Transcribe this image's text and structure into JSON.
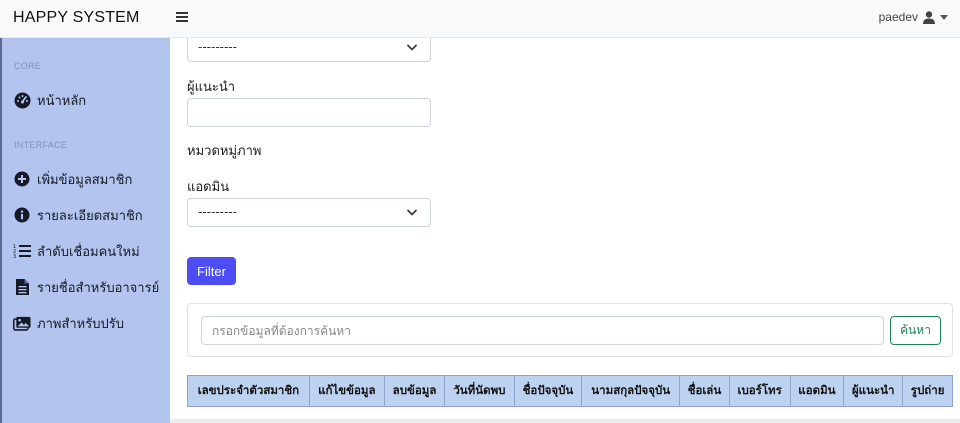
{
  "app": {
    "brand": "HAPPY SYSTEM",
    "user": "paedev"
  },
  "sidebar": {
    "headings": [
      "CORE",
      "INTERFACE"
    ],
    "items": [
      {
        "label": "หน้าหลัก",
        "icon": "dashboard-icon"
      },
      {
        "label": "เพิ่มข้อมูลสมาชิก",
        "icon": "plus-circle-icon"
      },
      {
        "label": "รายละเอียดสมาชิก",
        "icon": "info-circle-icon"
      },
      {
        "label": "ลำดับเชื่อมคนใหม่",
        "icon": "list-ordered-icon"
      },
      {
        "label": "รายชื่อสำหรับอาจารย์",
        "icon": "file-text-icon"
      },
      {
        "label": "ภาพสำหรับปรับ",
        "icon": "images-icon"
      }
    ]
  },
  "filters": {
    "top_select_value": "---------",
    "referrer_label": "ผู้แนะนำ",
    "referrer_value": "",
    "category_label": "หมวดหมู่ภาพ",
    "admin_label": "แอดมิน",
    "admin_value": "---------",
    "filter_button": "Filter"
  },
  "search": {
    "placeholder": "กรอกข้อมูลที่ต้องการค้นหา",
    "button": "ค้นหา"
  },
  "table": {
    "columns": [
      "เลขประจำตัวสมาชิก",
      "แก้ไขข้อมูล",
      "ลบข้อมูล",
      "วันที่นัดพบ",
      "ชื่อปัจจุบัน",
      "นามสกุลปัจจุบัน",
      "ชื่อเล่น",
      "เบอร์โทร",
      "แอดมิน",
      "ผู้แนะนำ",
      "รูปถ่าย"
    ]
  },
  "colors": {
    "sidebar_bg": "#b3c4ee",
    "primary": "#4d4df5",
    "success": "#198754",
    "table_header": "#bdd1f1"
  }
}
